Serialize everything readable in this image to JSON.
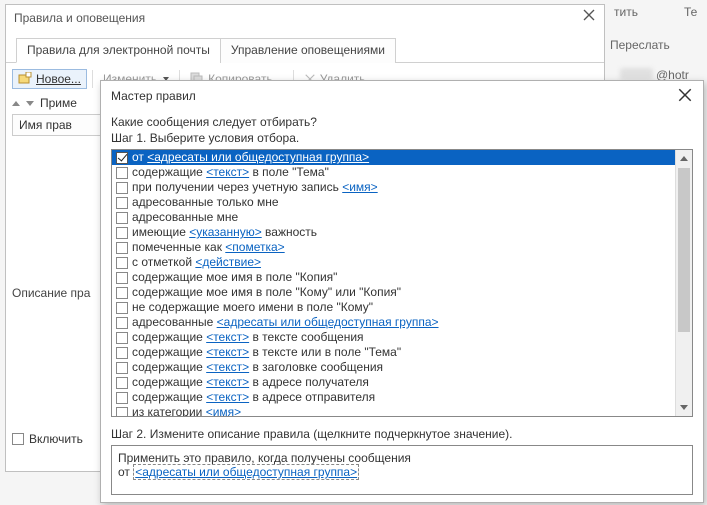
{
  "bg": {
    "forward": "Переслать",
    "hotr": "@hotr",
    "t": "Те",
    "dup": "тить"
  },
  "dlg1": {
    "title": "Правила и оповещения",
    "tabs": {
      "email": "Правила для электронной почты",
      "alerts": "Управление оповещениями"
    },
    "toolbar": {
      "new": "Новое...",
      "change": "Изменить ▾",
      "copy": "Копировать...",
      "delete": "Удалить"
    },
    "sort_label": "Приме",
    "grid_col": "Имя прав",
    "desc_label": "Описание пра",
    "include": "Включить"
  },
  "dlg2": {
    "title": "Мастер правил",
    "q": "Какие сообщения следует отбирать?",
    "step1": "Шаг 1. Выберите условия отбора.",
    "conditions": [
      {
        "checked": true,
        "parts": [
          "от ",
          {
            "link": "<адресаты или общедоступная группа>"
          }
        ]
      },
      {
        "checked": false,
        "parts": [
          "содержащие ",
          {
            "link": "<текст>"
          },
          " в поле \"Тема\""
        ]
      },
      {
        "checked": false,
        "parts": [
          "при получении через учетную запись ",
          {
            "link": "<имя>"
          }
        ]
      },
      {
        "checked": false,
        "parts": [
          "адресованные только мне"
        ]
      },
      {
        "checked": false,
        "parts": [
          "адресованные мне"
        ]
      },
      {
        "checked": false,
        "parts": [
          "имеющие ",
          {
            "link": "<указанную>"
          },
          " важность"
        ]
      },
      {
        "checked": false,
        "parts": [
          "помеченные как ",
          {
            "link": "<пометка>"
          }
        ]
      },
      {
        "checked": false,
        "parts": [
          "с отметкой ",
          {
            "link": "<действие>"
          }
        ]
      },
      {
        "checked": false,
        "parts": [
          "содержащие мое имя в поле \"Копия\""
        ]
      },
      {
        "checked": false,
        "parts": [
          "содержащие мое имя в поле \"Кому\" или \"Копия\""
        ]
      },
      {
        "checked": false,
        "parts": [
          "не содержащие моего имени в поле \"Кому\""
        ]
      },
      {
        "checked": false,
        "parts": [
          "адресованные ",
          {
            "link": "<адресаты или общедоступная группа>"
          }
        ]
      },
      {
        "checked": false,
        "parts": [
          "содержащие ",
          {
            "link": "<текст>"
          },
          " в тексте сообщения"
        ]
      },
      {
        "checked": false,
        "parts": [
          "содержащие ",
          {
            "link": "<текст>"
          },
          " в тексте или в поле \"Тема\""
        ]
      },
      {
        "checked": false,
        "parts": [
          "содержащие ",
          {
            "link": "<текст>"
          },
          " в заголовке сообщения"
        ]
      },
      {
        "checked": false,
        "parts": [
          "содержащие ",
          {
            "link": "<текст>"
          },
          " в адресе получателя"
        ]
      },
      {
        "checked": false,
        "parts": [
          "содержащие ",
          {
            "link": "<текст>"
          },
          " в адресе отправителя"
        ]
      },
      {
        "checked": false,
        "parts": [
          "из категории ",
          {
            "link": "<имя>"
          }
        ]
      }
    ],
    "step2": "Шаг 2. Измените описание правила (щелкните подчеркнутое значение).",
    "desc_line1": "Применить это правило, когда получены сообщения",
    "desc_prefix": "от",
    "desc_link": "<адресаты или общедоступная группа>"
  }
}
